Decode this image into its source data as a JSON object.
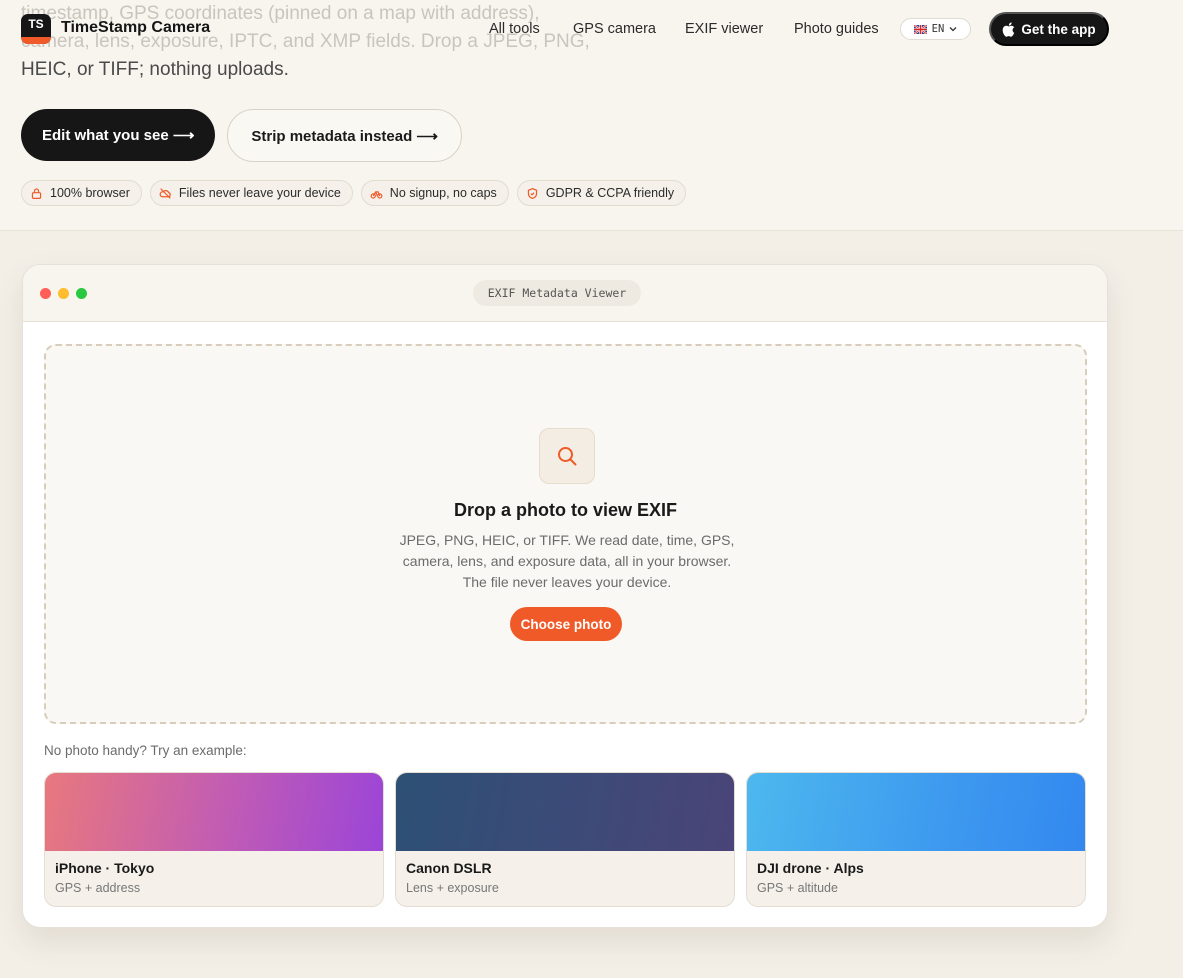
{
  "hero": {
    "desc_line1": "timestamp, GPS coordinates (pinned on a map with address),",
    "desc_line2": "camera, lens, exposure, IPTC, and XMP fields. Drop a JPEG, PNG,",
    "desc_line3": "HEIC, or TIFF; nothing uploads.",
    "cta_primary": "Edit what you see ⟶",
    "cta_secondary": "Strip metadata instead ⟶",
    "badges": [
      {
        "label": "100% browser",
        "icon": "lock-icon"
      },
      {
        "label": "Files never leave your device",
        "icon": "cloud-off-icon"
      },
      {
        "label": "No signup, no caps",
        "icon": "bike-icon"
      },
      {
        "label": "GDPR & CCPA friendly",
        "icon": "shield-icon"
      }
    ]
  },
  "nav": {
    "logo_text": "TS",
    "brand": "TimeStamp Camera",
    "links": [
      "All tools",
      "GPS camera",
      "EXIF viewer",
      "Photo guides"
    ],
    "lang": "EN",
    "get_app": "Get the app"
  },
  "viewer": {
    "window_title": "EXIF Metadata Viewer",
    "drop_title": "Drop a photo to view EXIF",
    "drop_desc": "JPEG, PNG, HEIC, or TIFF. We read date, time, GPS, camera, lens, and exposure data, all in your browser. The file never leaves your device.",
    "choose_button": "Choose photo",
    "examples_label": "No photo handy? Try an example:",
    "examples": [
      {
        "name": "iPhone · Tokyo",
        "sub": "GPS + address"
      },
      {
        "name": "Canon DSLR",
        "sub": "Lens + exposure"
      },
      {
        "name": "DJI drone · Alps",
        "sub": "GPS + altitude"
      }
    ]
  },
  "colors": {
    "accent": "#f05a28",
    "dark": "#161616",
    "background": "#f3efe7"
  }
}
